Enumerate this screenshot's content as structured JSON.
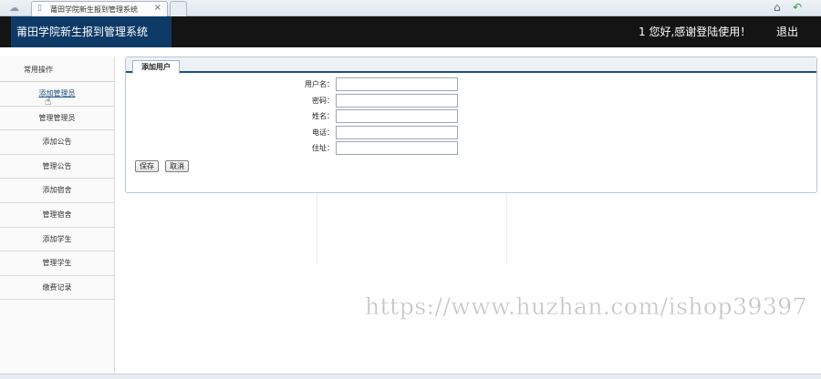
{
  "browser": {
    "tab_title": "莆田学院新生报到管理系统",
    "tab_close": "×"
  },
  "header": {
    "app_title": "莆田学院新生报到管理系统",
    "welcome": "1 您好,感谢登陆使用！",
    "logout": "退出"
  },
  "sidebar": {
    "heading": "常用操作",
    "items": [
      {
        "label": "添加管理员"
      },
      {
        "label": "管理管理员"
      },
      {
        "label": "添加公告"
      },
      {
        "label": "管理公告"
      },
      {
        "label": "添加宿舍"
      },
      {
        "label": "管理宿舍"
      },
      {
        "label": "添加学生"
      },
      {
        "label": "管理学生"
      },
      {
        "label": "缴费记录"
      }
    ]
  },
  "panel": {
    "tab": "添加用户",
    "fields": [
      {
        "label": "用户名：",
        "value": ""
      },
      {
        "label": "密码：",
        "value": ""
      },
      {
        "label": "姓名：",
        "value": ""
      },
      {
        "label": "电话：",
        "value": ""
      },
      {
        "label": "住址：",
        "value": ""
      }
    ],
    "save_label": "保存",
    "cancel_label": "取消"
  },
  "watermark": "https://www.huzhan.com/ishop39397"
}
